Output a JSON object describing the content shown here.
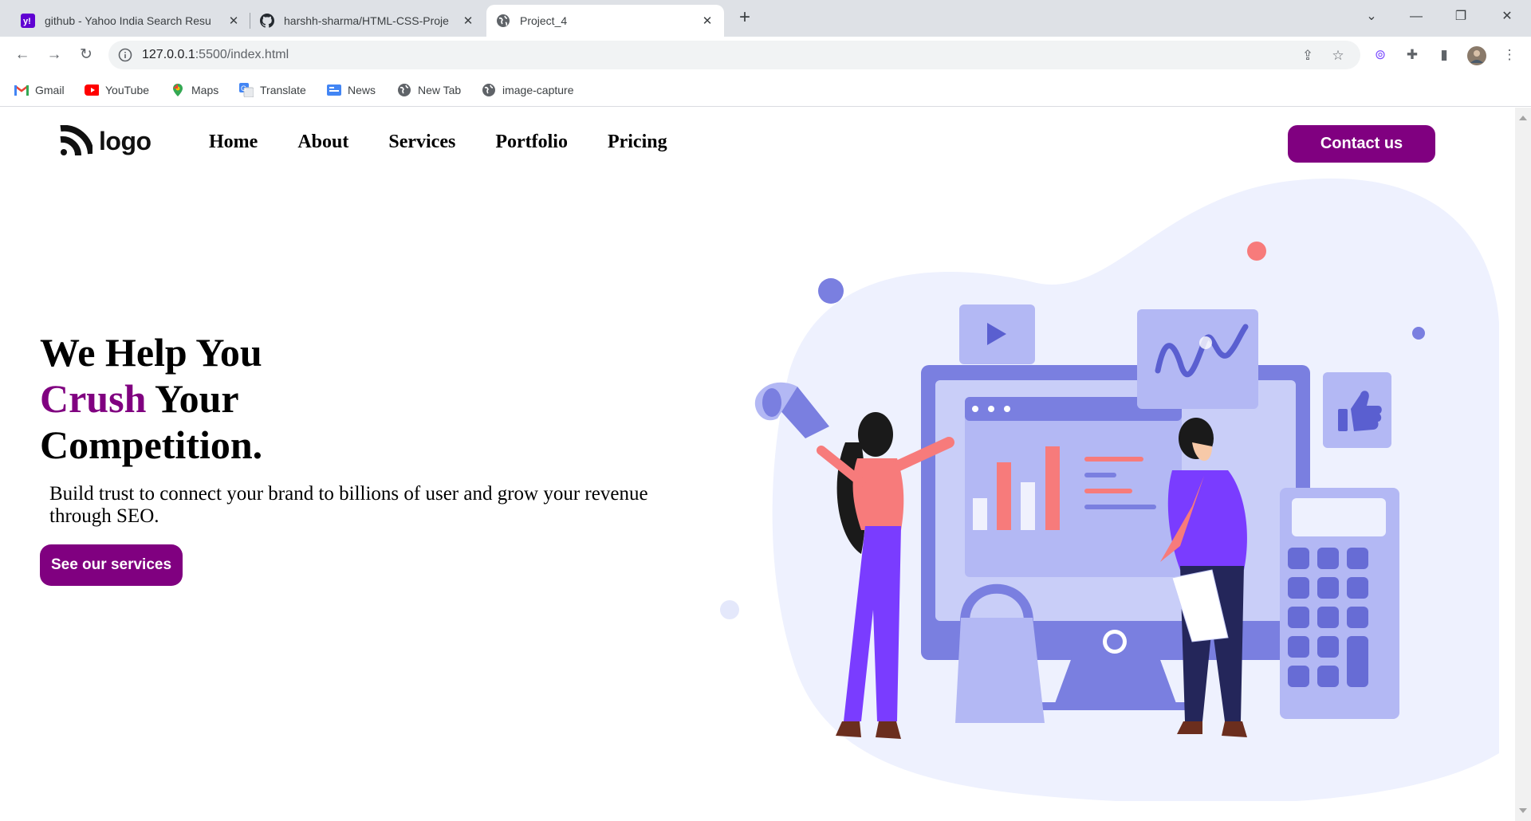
{
  "browser": {
    "tabs": [
      {
        "title": "github - Yahoo India Search Resu",
        "icon": "yahoo-icon"
      },
      {
        "title": "harshh-sharma/HTML-CSS-Proje",
        "icon": "github-icon"
      },
      {
        "title": "Project_4",
        "icon": "globe-icon"
      }
    ],
    "url_host": "127.0.0.1",
    "url_rest": ":5500/index.html",
    "bookmarks": [
      {
        "label": "Gmail",
        "icon": "gmail-icon"
      },
      {
        "label": "YouTube",
        "icon": "youtube-icon"
      },
      {
        "label": "Maps",
        "icon": "maps-icon"
      },
      {
        "label": "Translate",
        "icon": "translate-icon"
      },
      {
        "label": "News",
        "icon": "news-icon"
      },
      {
        "label": "New Tab",
        "icon": "globe-icon"
      },
      {
        "label": "image-capture",
        "icon": "globe-icon"
      }
    ]
  },
  "site": {
    "logo_text": "logo",
    "nav": [
      "Home",
      "About",
      "Services",
      "Portfolio",
      "Pricing"
    ],
    "contact_label": "Contact us",
    "hero": {
      "line1": "We Help You",
      "accent": "Crush",
      "line2_rest": " Your",
      "line3": "Competition.",
      "subtitle": "Build trust to connect your brand to billions of user and grow your revenue through SEO.",
      "cta_label": "See our services"
    },
    "colors": {
      "brand": "#800080",
      "illustration_primary": "#7a7fe0",
      "illustration_light": "#eef1fe"
    }
  }
}
